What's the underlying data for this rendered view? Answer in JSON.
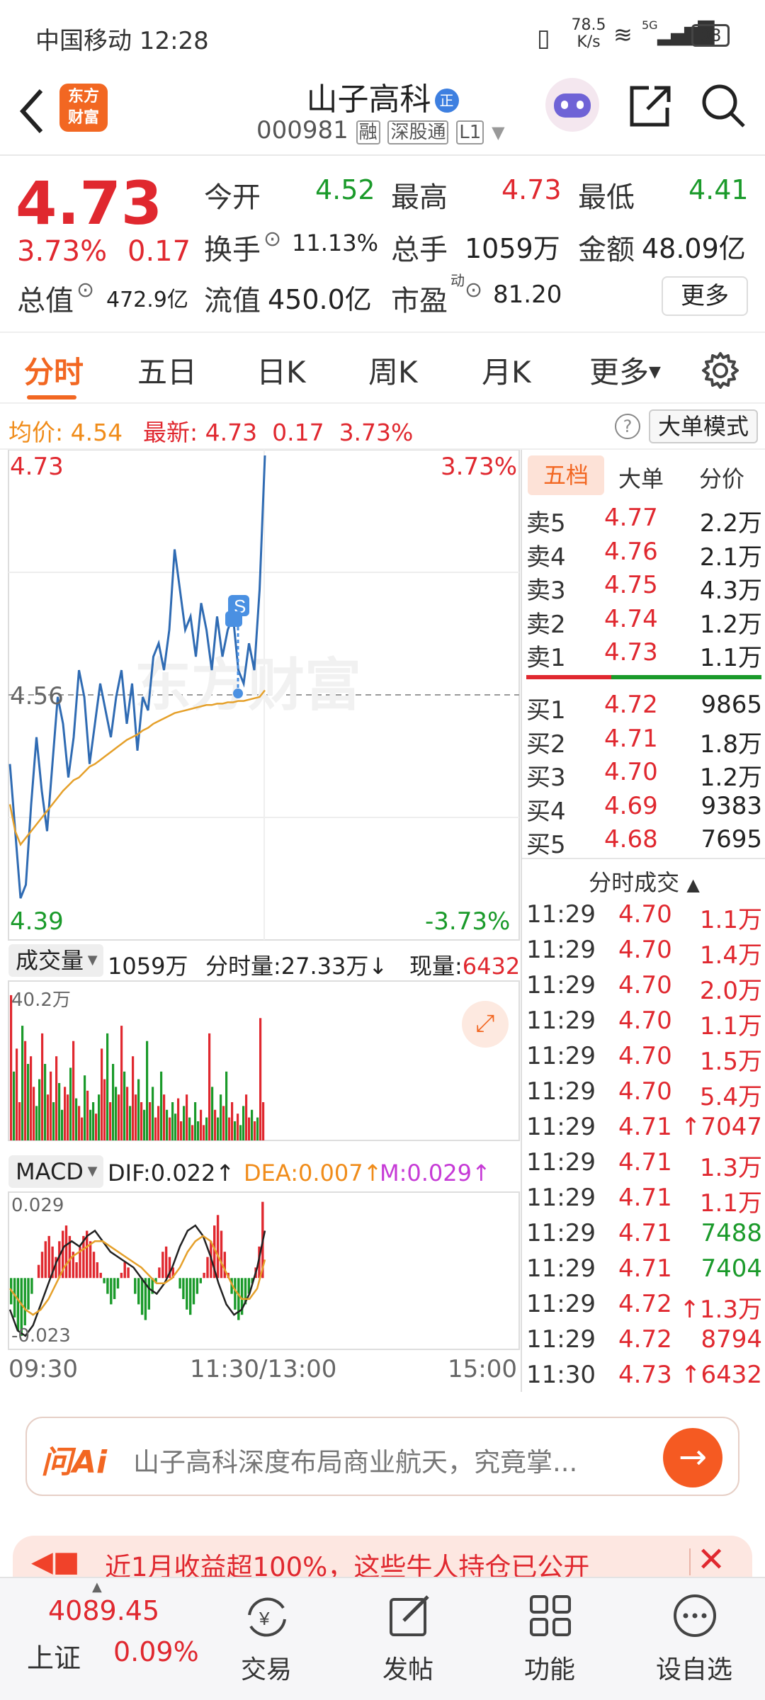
{
  "status_bar": {
    "carrier_time": "中国移动 12:28",
    "net_speed_value": "78.5",
    "net_speed_unit": "K/s",
    "net_type": "5G",
    "battery": "98"
  },
  "header": {
    "logo_line1": "东方",
    "logo_line2": "财富",
    "stock_name": "山子高科",
    "name_badge": "正",
    "stock_code": "000981",
    "tag_margin": "融",
    "tag_connect": "深股通",
    "tag_level": "L1"
  },
  "quote": {
    "price": "4.73",
    "change_pct": "3.73%",
    "change_amt": "0.17",
    "open_label": "今开",
    "open": "4.52",
    "high_label": "最高",
    "high": "4.73",
    "low_label": "最低",
    "low": "4.41",
    "turnover_label": "换手",
    "turnover": "11.13%",
    "volume_label": "总手",
    "volume": "1059万",
    "amount_label": "金额",
    "amount": "48.09亿",
    "mktcap_label": "总值",
    "mktcap": "472.9亿",
    "float_label": "流值",
    "float_cap": "450.0亿",
    "pe_label": "市盈",
    "pe_sup": "动",
    "pe": "81.20",
    "more_button": "更多"
  },
  "tabs": {
    "items": [
      "分时",
      "五日",
      "日K",
      "周K",
      "月K",
      "更多"
    ],
    "active": 0
  },
  "info_bar": {
    "avg_label": "均价:",
    "avg": "4.54",
    "latest_label": "最新:",
    "latest": "4.73",
    "latest_chg": "0.17",
    "latest_pct": "3.73%",
    "mode_button": "大单模式"
  },
  "intraday": {
    "y_top": "4.73",
    "y_mid": "4.56",
    "y_bottom": "4.39",
    "pct_top": "3.73%",
    "pct_bottom": "-3.73%",
    "watermark": "东方财富",
    "marker": "S"
  },
  "chart_data": {
    "type": "line",
    "ylim": [
      4.39,
      4.73
    ],
    "reference": 4.56,
    "x_labels": [
      "09:30",
      "11:30/13:00",
      "15:00"
    ],
    "series": [
      {
        "name": "price",
        "color": "#2f6bb3",
        "values": [
          4.5,
          4.45,
          4.4,
          4.41,
          4.47,
          4.52,
          4.48,
          4.45,
          4.5,
          4.55,
          4.53,
          4.49,
          4.52,
          4.57,
          4.55,
          4.5,
          4.53,
          4.56,
          4.54,
          4.52,
          4.55,
          4.57,
          4.53,
          4.56,
          4.51,
          4.55,
          4.54,
          4.58,
          4.59,
          4.57,
          4.6,
          4.66,
          4.63,
          4.6,
          4.61,
          4.58,
          4.62,
          4.6,
          4.57,
          4.61,
          4.58,
          4.6,
          4.61,
          4.57,
          4.56,
          4.59,
          4.57,
          4.63,
          4.73
        ]
      },
      {
        "name": "avg",
        "color": "#e5a02a",
        "values": [
          4.47,
          4.45,
          4.44,
          4.445,
          4.45,
          4.455,
          4.46,
          4.465,
          4.47,
          4.475,
          4.48,
          4.484,
          4.488,
          4.49,
          4.494,
          4.498,
          4.5,
          4.503,
          4.506,
          4.509,
          4.512,
          4.515,
          4.518,
          4.52,
          4.522,
          4.525,
          4.527,
          4.53,
          4.532,
          4.534,
          4.536,
          4.538,
          4.539,
          4.54,
          4.541,
          4.542,
          4.543,
          4.544,
          4.544,
          4.545,
          4.545,
          4.546,
          4.546,
          4.547,
          4.547,
          4.548,
          4.549,
          4.55,
          4.555
        ]
      }
    ]
  },
  "volume": {
    "label": "成交量",
    "total": "1059万",
    "minute_label": "分时量:27.33万↓",
    "now_label": "现量:",
    "now": "6432",
    "ymax": "40.2万"
  },
  "volume_data": {
    "max": 40.2,
    "values": [
      38,
      18,
      24,
      10,
      30,
      26,
      20,
      22,
      14,
      9,
      16,
      28,
      20,
      12,
      18,
      10,
      22,
      15,
      8,
      14,
      12,
      19,
      26,
      11,
      9,
      6,
      17,
      13,
      8,
      10,
      7,
      12,
      24,
      16,
      28,
      10,
      20,
      14,
      12,
      30,
      18,
      14,
      9,
      22,
      12,
      16,
      10,
      8,
      26,
      10,
      14,
      6,
      9,
      18,
      12,
      8,
      6,
      10,
      7,
      11,
      5,
      9,
      12,
      6,
      4,
      10,
      5,
      8,
      4,
      6,
      28,
      14,
      8,
      6,
      12,
      9,
      18,
      6,
      10,
      5,
      7,
      4,
      9,
      12,
      6,
      8,
      5,
      6,
      32,
      10
    ],
    "up": [
      1,
      0,
      1,
      1,
      0,
      1,
      0,
      1,
      1,
      0,
      0,
      1,
      0,
      1,
      1,
      0,
      1,
      0,
      0,
      1,
      1,
      0,
      1,
      0,
      1,
      1,
      0,
      1,
      0,
      0,
      1,
      0,
      1,
      1,
      0,
      1,
      0,
      0,
      1,
      1,
      0,
      1,
      0,
      1,
      1,
      0,
      1,
      0,
      0,
      1,
      0,
      1,
      1,
      0,
      1,
      0,
      1,
      0,
      0,
      1,
      1,
      0,
      1,
      0,
      1,
      0,
      0,
      1,
      1,
      0,
      1,
      0,
      1,
      0,
      0,
      1,
      0,
      1,
      1,
      0,
      1,
      0,
      0,
      1,
      1,
      0,
      1,
      0,
      1,
      1
    ]
  },
  "macd": {
    "label": "MACD",
    "dif": "DIF:0.022↑",
    "dea": "DEA:0.007↑",
    "m": "M:0.029↑",
    "ymax": "0.029",
    "ymin": "-0.023"
  },
  "macd_data": {
    "bars": [
      -0.01,
      -0.015,
      -0.02,
      -0.022,
      -0.018,
      -0.012,
      -0.006,
      0.0,
      0.005,
      0.01,
      0.014,
      0.016,
      0.012,
      0.008,
      0.014,
      0.018,
      0.02,
      0.016,
      0.01,
      0.006,
      0.012,
      0.016,
      0.018,
      0.014,
      0.01,
      0.006,
      0.002,
      -0.002,
      -0.006,
      -0.01,
      -0.008,
      -0.004,
      0.002,
      0.006,
      0.004,
      0.0,
      -0.006,
      -0.01,
      -0.014,
      -0.016,
      -0.012,
      -0.006,
      -0.002,
      0.004,
      0.01,
      0.012,
      0.008,
      0.004,
      0.0,
      -0.004,
      -0.008,
      -0.012,
      -0.014,
      -0.01,
      -0.006,
      -0.002,
      0.002,
      0.008,
      0.014,
      0.02,
      0.024,
      0.018,
      0.01,
      0.002,
      -0.006,
      -0.012,
      -0.016,
      -0.014,
      -0.01,
      -0.006,
      -0.002,
      0.004,
      0.012,
      0.029
    ],
    "dif": [
      -0.012,
      -0.02,
      -0.022,
      -0.018,
      -0.01,
      -0.002,
      0.006,
      0.012,
      0.014,
      0.012,
      0.016,
      0.018,
      0.014,
      0.01,
      0.008,
      0.006,
      0.004,
      0.0,
      -0.004,
      -0.006,
      -0.002,
      0.004,
      0.012,
      0.018,
      0.02,
      0.016,
      0.008,
      -0.002,
      -0.01,
      -0.014,
      -0.012,
      -0.006,
      0.004,
      0.018
    ],
    "dea": [
      -0.004,
      -0.008,
      -0.012,
      -0.014,
      -0.012,
      -0.008,
      -0.002,
      0.004,
      0.008,
      0.01,
      0.012,
      0.014,
      0.014,
      0.012,
      0.01,
      0.008,
      0.006,
      0.004,
      0.001,
      -0.002,
      -0.002,
      0.0,
      0.004,
      0.01,
      0.014,
      0.016,
      0.014,
      0.008,
      0.002,
      -0.004,
      -0.008,
      -0.008,
      -0.004,
      0.007
    ]
  },
  "x_axis": {
    "start": "09:30",
    "mid": "11:30/13:00",
    "end": "15:00"
  },
  "order_book": {
    "tabs": [
      "五档",
      "大单",
      "分价"
    ],
    "asks": [
      {
        "label": "卖5",
        "price": "4.77",
        "vol": "2.2万"
      },
      {
        "label": "卖4",
        "price": "4.76",
        "vol": "2.1万"
      },
      {
        "label": "卖3",
        "price": "4.75",
        "vol": "4.3万"
      },
      {
        "label": "卖2",
        "price": "4.74",
        "vol": "1.2万"
      },
      {
        "label": "卖1",
        "price": "4.73",
        "vol": "1.1万"
      }
    ],
    "bids": [
      {
        "label": "买1",
        "price": "4.72",
        "vol": "9865"
      },
      {
        "label": "买2",
        "price": "4.71",
        "vol": "1.8万"
      },
      {
        "label": "买3",
        "price": "4.70",
        "vol": "1.2万"
      },
      {
        "label": "买4",
        "price": "4.69",
        "vol": "9383"
      },
      {
        "label": "买5",
        "price": "4.68",
        "vol": "7695"
      }
    ],
    "trades_title": "分时成交",
    "trades": [
      {
        "time": "11:29",
        "price": "4.70",
        "vol": "1.1万",
        "color": "#e0282f"
      },
      {
        "time": "11:29",
        "price": "4.70",
        "vol": "1.4万",
        "color": "#e0282f"
      },
      {
        "time": "11:29",
        "price": "4.70",
        "vol": "2.0万",
        "color": "#e0282f"
      },
      {
        "time": "11:29",
        "price": "4.70",
        "vol": "1.1万",
        "color": "#e0282f"
      },
      {
        "time": "11:29",
        "price": "4.70",
        "vol": "1.5万",
        "color": "#e0282f"
      },
      {
        "time": "11:29",
        "price": "4.70",
        "vol": "5.4万",
        "color": "#e0282f"
      },
      {
        "time": "11:29",
        "price": "4.71",
        "vol": "↑7047",
        "color": "#e0282f"
      },
      {
        "time": "11:29",
        "price": "4.71",
        "vol": "1.3万",
        "color": "#e0282f"
      },
      {
        "time": "11:29",
        "price": "4.71",
        "vol": "1.1万",
        "color": "#e0282f"
      },
      {
        "time": "11:29",
        "price": "4.71",
        "vol": "7488",
        "color": "#1a9a2a"
      },
      {
        "time": "11:29",
        "price": "4.71",
        "vol": "7404",
        "color": "#1a9a2a"
      },
      {
        "time": "11:29",
        "price": "4.72",
        "vol": "↑1.3万",
        "color": "#e0282f"
      },
      {
        "time": "11:29",
        "price": "4.72",
        "vol": "8794",
        "color": "#e0282f"
      },
      {
        "time": "11:30",
        "price": "4.73",
        "vol": "↑6432",
        "color": "#e0282f"
      }
    ]
  },
  "ask_ai": {
    "logo": "问Ai",
    "prompt": "山子高科深度布局商业航天，究竟掌..."
  },
  "banner": {
    "text": "近1月收益超100%，这些牛人持仓已公开"
  },
  "bottom_nav": {
    "index_value": "4089.45",
    "index_name": "上证",
    "index_pct": "0.09%",
    "trade": "交易",
    "post": "发帖",
    "func": "功能",
    "watch": "设自选"
  },
  "colors": {
    "up": "#e0282f",
    "down": "#1a9a2a",
    "accent": "#f26722",
    "line": "#2f6bb3",
    "avg": "#e5a02a"
  }
}
